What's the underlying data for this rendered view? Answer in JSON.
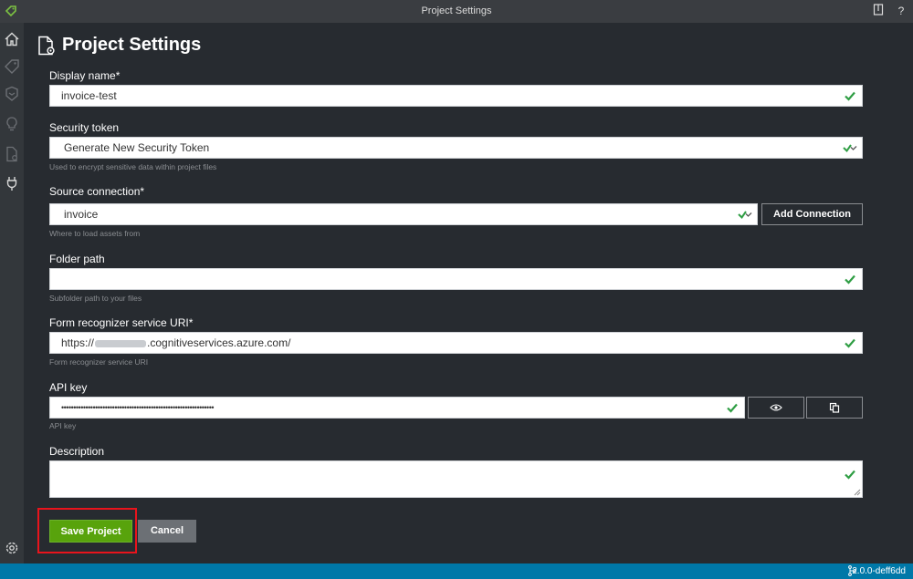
{
  "window": {
    "title": "Project Settings"
  },
  "page": {
    "title": "Project Settings"
  },
  "fields": {
    "display_name": {
      "label": "Display name*",
      "value": "invoice-test"
    },
    "security_token": {
      "label": "Security token",
      "value": "Generate New Security Token",
      "help": "Used to encrypt sensitive data within project files"
    },
    "source_connection": {
      "label": "Source connection*",
      "value": "invoice",
      "help": "Where to load assets from",
      "add_label": "Add Connection"
    },
    "folder_path": {
      "label": "Folder path",
      "value": "",
      "help": "Subfolder path to your files"
    },
    "form_recognizer_uri": {
      "label": "Form recognizer service URI*",
      "value_prefix": "https://",
      "value_suffix": ".cognitiveservices.azure.com/",
      "help": "Form recognizer service URI"
    },
    "api_key": {
      "label": "API key",
      "value": "•••••••••••••••••••••••••••••••••••••••••••••••••••••••••••••••",
      "help": "API key"
    },
    "description": {
      "label": "Description",
      "value": ""
    }
  },
  "actions": {
    "save_label": "Save Project",
    "cancel_label": "Cancel"
  },
  "status": {
    "version": "2.0.0-deff6dd"
  },
  "colors": {
    "accent_green": "#58a30c",
    "check_green": "#2f9e44",
    "status_blue": "#0078a8",
    "highlight_red": "#e8141c"
  }
}
